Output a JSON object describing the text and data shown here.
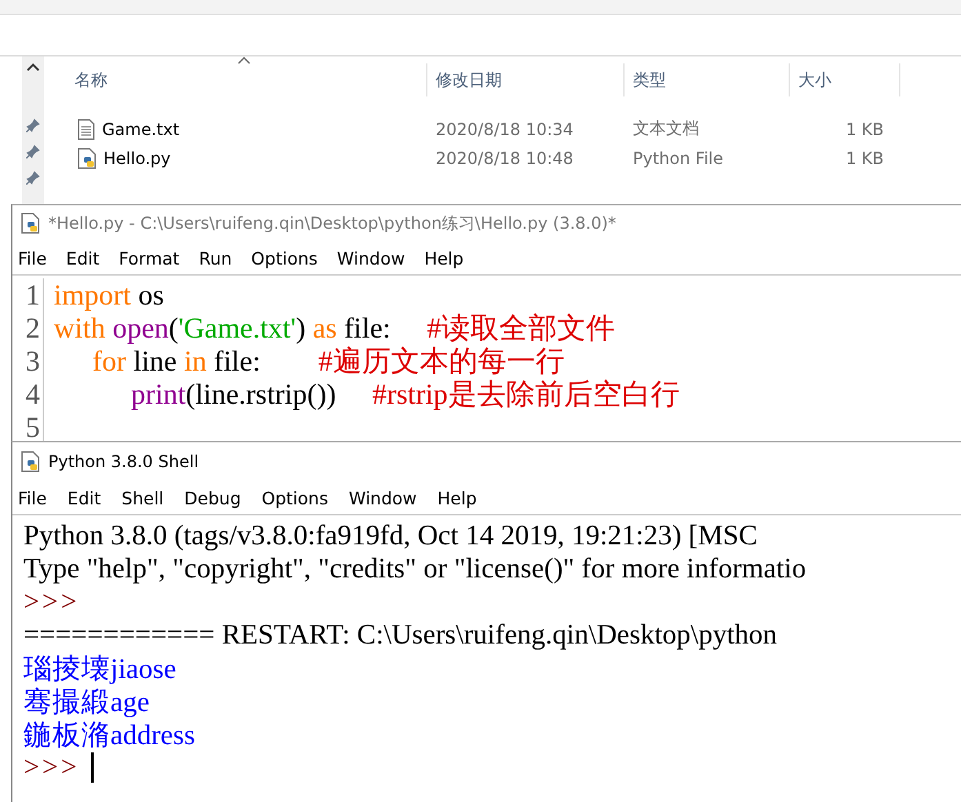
{
  "explorer": {
    "columns": [
      {
        "label": "名称",
        "sorted": true
      },
      {
        "label": "修改日期",
        "sorted": false
      },
      {
        "label": "类型",
        "sorted": false
      },
      {
        "label": "大小",
        "sorted": false
      }
    ],
    "files": [
      {
        "kind": "text",
        "name": "Game.txt",
        "modified": "2020/8/18 10:34",
        "type": "文本文档",
        "size": "1 KB"
      },
      {
        "kind": "python",
        "name": "Hello.py",
        "modified": "2020/8/18 10:48",
        "type": "Python File",
        "size": "1 KB"
      }
    ]
  },
  "editor": {
    "title": "*Hello.py - C:\\Users\\ruifeng.qin\\Desktop\\python练习\\Hello.py (3.8.0)*",
    "menu": [
      "File",
      "Edit",
      "Format",
      "Run",
      "Options",
      "Window",
      "Help"
    ],
    "lines": [
      {
        "number": "1",
        "tokens": [
          {
            "kind": "keyword",
            "text": "import"
          },
          {
            "kind": "plain",
            "text": " os"
          }
        ]
      },
      {
        "number": "2",
        "tokens": [
          {
            "kind": "keyword",
            "text": "with"
          },
          {
            "kind": "builtin",
            "text": " open"
          },
          {
            "kind": "plain",
            "text": "("
          },
          {
            "kind": "string",
            "text": "'Game.txt'"
          },
          {
            "kind": "plain",
            "text": ") "
          },
          {
            "kind": "keyword",
            "text": "as"
          },
          {
            "kind": "plain",
            "text": " file:     "
          },
          {
            "kind": "comment",
            "text": "#读取全部文件"
          }
        ],
        "children": [
          {
            "number": "3",
            "tokens": [
              {
                "kind": "keyword",
                "text": "for"
              },
              {
                "kind": "plain",
                "text": " line "
              },
              {
                "kind": "keyword",
                "text": "in"
              },
              {
                "kind": "plain",
                "text": " file:        "
              },
              {
                "kind": "comment",
                "text": "#遍历文本的每一行"
              }
            ],
            "children": [
              {
                "number": "4",
                "tokens": [
                  {
                    "kind": "builtin",
                    "text": "print"
                  },
                  {
                    "kind": "plain",
                    "text": "(line.rstrip())     "
                  },
                  {
                    "kind": "comment",
                    "text": "#rstrip是去除前后空白行"
                  }
                ]
              }
            ]
          }
        ]
      },
      {
        "number": "5"
      }
    ]
  },
  "shell": {
    "title": "Python 3.8.0 Shell",
    "menu": [
      "File",
      "Edit",
      "Shell",
      "Debug",
      "Options",
      "Window",
      "Help"
    ],
    "lines": [
      {
        "kind": "output",
        "text": "Python 3.8.0 (tags/v3.8.0:fa919fd, Oct 14 2019, 19:21:23) [MSC"
      },
      {
        "kind": "output",
        "text": "Type \"help\", \"copyright\", \"credits\" or \"license()\" for more informatio"
      },
      {
        "kind": "prompt",
        "text": ">>>",
        "cursor": false
      },
      {
        "kind": "output",
        "text": "============ RESTART: C:\\Users\\ruifeng.qin\\Desktop\\python"
      },
      {
        "kind": "result",
        "text": "瑙掕壊jiaose"
      },
      {
        "kind": "result",
        "text": "骞撮緞age"
      },
      {
        "kind": "result",
        "text": "鍦板潃address"
      },
      {
        "kind": "prompt",
        "text": ">>>",
        "cursor": true
      }
    ]
  }
}
